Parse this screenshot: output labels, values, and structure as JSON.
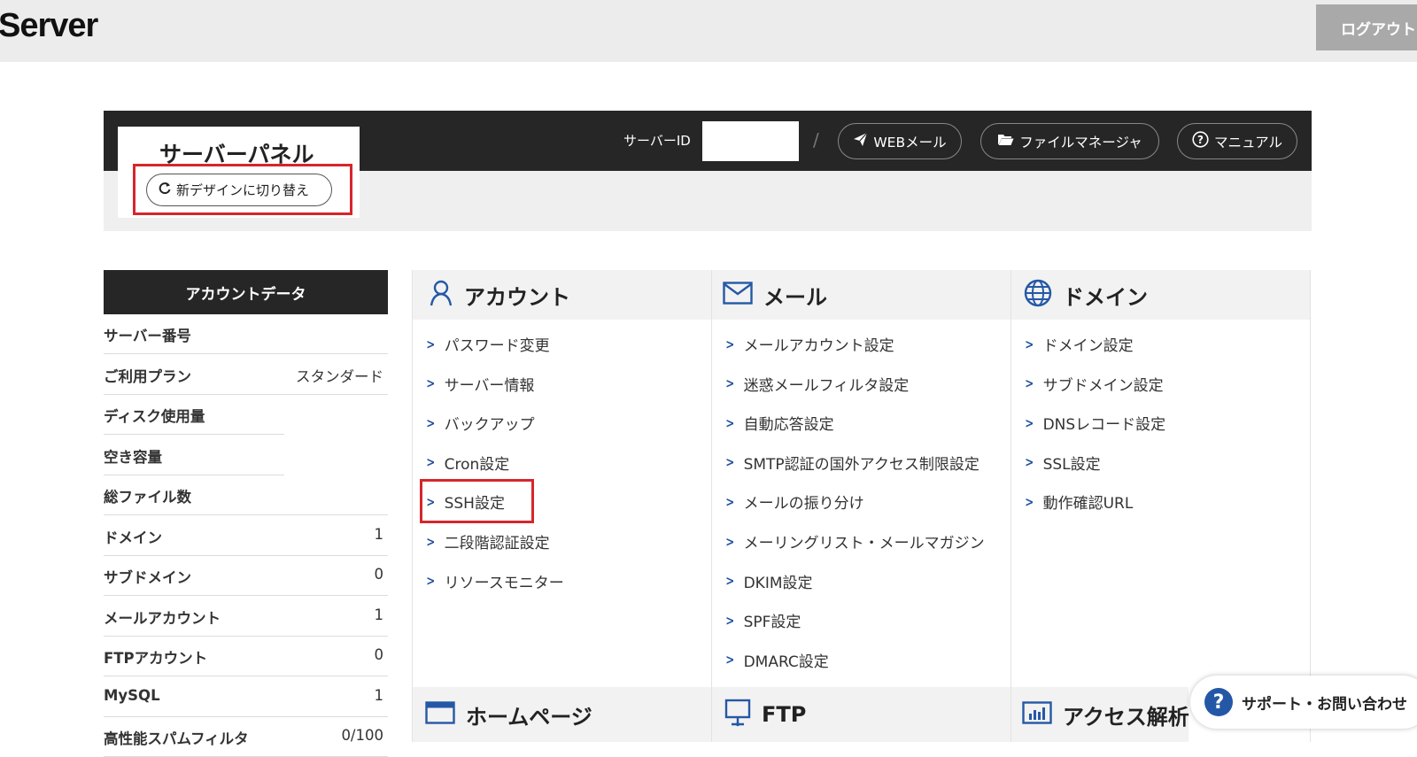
{
  "header": {
    "logo": "Server",
    "logout_label": "ログアウト"
  },
  "panel": {
    "title": "サーバーパネル",
    "switch_design_label": "新デザインに切り替え",
    "server_id_label": "サーバーID",
    "server_id_value": "",
    "separator": "/",
    "webmail_label": "WEBメール",
    "file_manager_label": "ファイルマネージャ",
    "manual_label": "マニュアル"
  },
  "sidebar": {
    "title": "アカウントデータ",
    "rows": [
      {
        "label": "サーバー番号",
        "value": ""
      },
      {
        "label": "ご利用プラン",
        "value": "スタンダード"
      },
      {
        "label": "ディスク使用量",
        "value": ""
      },
      {
        "label": "空き容量",
        "value": ""
      },
      {
        "label": "総ファイル数",
        "value": ""
      },
      {
        "label": "ドメイン",
        "value": "1"
      },
      {
        "label": "サブドメイン",
        "value": "0"
      },
      {
        "label": "メールアカウント",
        "value": "1"
      },
      {
        "label": "FTPアカウント",
        "value": "0"
      },
      {
        "label": "MySQL",
        "value": "1"
      },
      {
        "label": "高性能スパムフィルタ",
        "value": "0/100"
      }
    ]
  },
  "sections": {
    "account": {
      "title": "アカウント",
      "icon": "user-icon",
      "items": [
        "パスワード変更",
        "サーバー情報",
        "バックアップ",
        "Cron設定",
        "SSH設定",
        "二段階認証設定",
        "リソースモニター"
      ]
    },
    "mail": {
      "title": "メール",
      "icon": "envelope-icon",
      "items": [
        "メールアカウント設定",
        "迷惑メールフィルタ設定",
        "自動応答設定",
        "SMTP認証の国外アクセス制限設定",
        "メールの振り分け",
        "メーリングリスト・メールマガジン",
        "DKIM設定",
        "SPF設定",
        "DMARC設定"
      ]
    },
    "domain": {
      "title": "ドメイン",
      "icon": "globe-icon",
      "items": [
        "ドメイン設定",
        "サブドメイン設定",
        "DNSレコード設定",
        "SSL設定",
        "動作確認URL"
      ]
    },
    "homepage": {
      "title": "ホームページ",
      "icon": "browser-window-icon"
    },
    "ftp": {
      "title": "FTP",
      "icon": "monitor-icon"
    },
    "analytics": {
      "title": "アクセス解析",
      "icon": "bar-chart-icon"
    }
  },
  "support": {
    "label": "サポート・お問い合わせ",
    "icon": "question-icon"
  },
  "colors": {
    "dark_bar": "#262626",
    "accent_blue": "#1f4f9e",
    "highlight_red": "#d6262b"
  }
}
